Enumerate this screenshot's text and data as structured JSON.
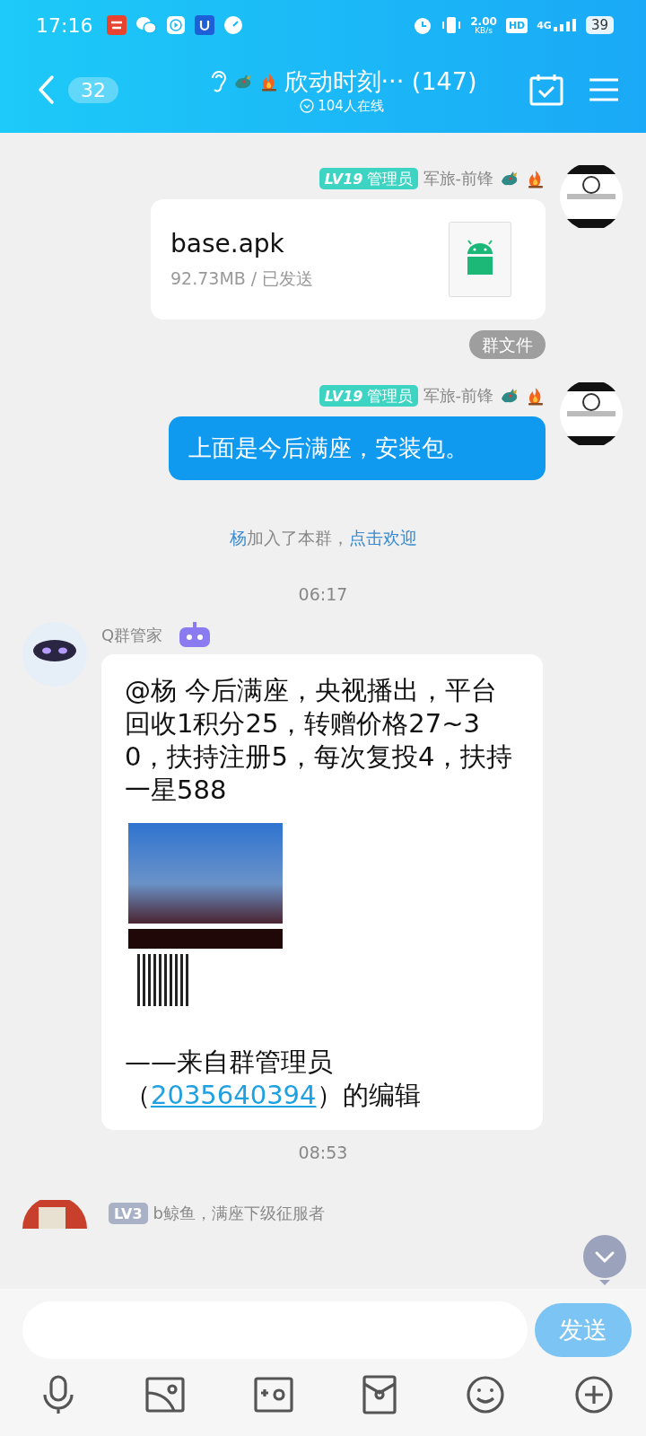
{
  "status_bar": {
    "time": "17:16",
    "net_speed": "2.00",
    "net_unit": "KB/s",
    "hd": "HD",
    "network": "4G",
    "battery": "39"
  },
  "header": {
    "back_count": "32",
    "title": "欣动时刻··· (147)",
    "online": "104人在线"
  },
  "messages": [
    {
      "kind": "file",
      "level": "LV19",
      "role": "管理员",
      "sender": "军旅-前锋",
      "file_name": "base.apk",
      "file_meta": "92.73MB / 已发送",
      "tag": "群文件"
    },
    {
      "kind": "text",
      "level": "LV19",
      "role": "管理员",
      "sender": "军旅-前锋",
      "text": "上面是今后满座，安装包。"
    },
    {
      "kind": "notice",
      "name": "杨",
      "text": "加入了本群，",
      "link": "点击欢迎"
    },
    {
      "kind": "time",
      "text": "06:17"
    },
    {
      "kind": "bot",
      "sender": "Q群管家",
      "text": "@杨 今后满座，央视播出，平台回收1积分25，转赠价格27~30，扶持注册5，每次复投4，扶持一星588",
      "signature_start": "——来自群管理员（",
      "signature_link": "2035640394",
      "signature_end": "）的编辑"
    },
    {
      "kind": "time",
      "text": "08:53"
    },
    {
      "kind": "preview",
      "level": "LV3",
      "sender": "b鲸鱼，满座下级征服者"
    }
  ],
  "composer": {
    "send": "发送"
  }
}
